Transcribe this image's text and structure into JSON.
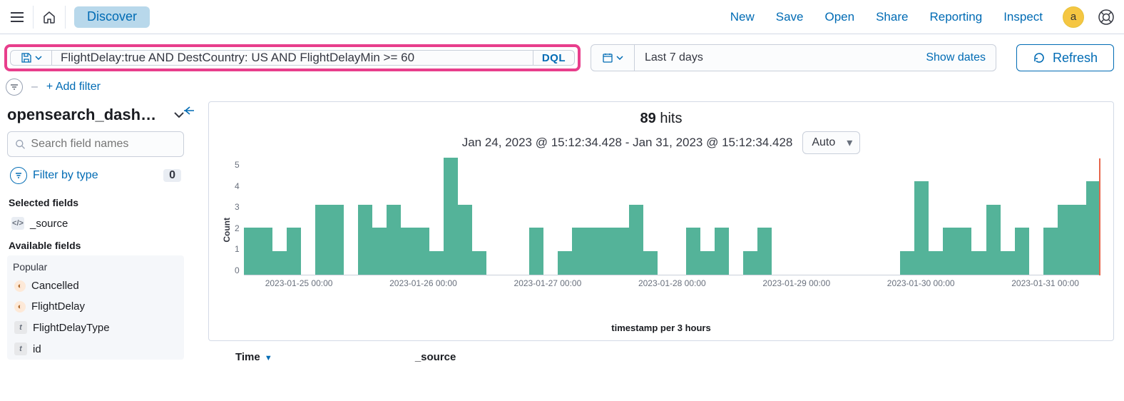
{
  "topnav": {
    "breadcrumb": "Discover",
    "links": [
      "New",
      "Save",
      "Open",
      "Share",
      "Reporting",
      "Inspect"
    ],
    "avatar_initial": "a"
  },
  "querybar": {
    "query_value": "FlightDelay:true AND DestCountry: US AND FlightDelayMin >= 60",
    "lang_label": "DQL",
    "date_label": "Last 7 days",
    "show_dates": "Show dates",
    "refresh_label": "Refresh"
  },
  "filters": {
    "add_filter_label": "+ Add filter"
  },
  "sidebar": {
    "index_pattern": "opensearch_dashbo…",
    "search_placeholder": "Search field names",
    "filter_by_type_label": "Filter by type",
    "filter_by_type_count": "0",
    "selected_heading": "Selected fields",
    "selected": [
      {
        "icon": "code",
        "label": "_source"
      }
    ],
    "available_heading": "Available fields",
    "popular_label": "Popular",
    "popular_fields": [
      {
        "icon": "bool",
        "label": "Cancelled"
      },
      {
        "icon": "bool",
        "label": "FlightDelay"
      },
      {
        "icon": "str",
        "label": "FlightDelayType"
      },
      {
        "icon": "str",
        "label": "id"
      }
    ]
  },
  "results": {
    "hits_count": "89",
    "hits_word": "hits",
    "date_range_text": "Jan 24, 2023 @ 15:12:34.428 - Jan 31, 2023 @ 15:12:34.428",
    "interval": "Auto",
    "xaxis_title": "timestamp per 3 hours",
    "yaxis_title": "Count",
    "table_columns": {
      "time": "Time",
      "source": "_source"
    }
  },
  "chart_data": {
    "type": "bar",
    "xlabel": "timestamp per 3 hours",
    "ylabel": "Count",
    "ylim": [
      0,
      5
    ],
    "y_ticks": [
      0,
      1,
      2,
      3,
      4,
      5
    ],
    "x_ticks": [
      "2023-01-25 00:00",
      "2023-01-26 00:00",
      "2023-01-27 00:00",
      "2023-01-28 00:00",
      "2023-01-29 00:00",
      "2023-01-30 00:00",
      "2023-01-31 00:00"
    ],
    "values": [
      2,
      2,
      1,
      2,
      0,
      3,
      3,
      0,
      3,
      2,
      3,
      2,
      2,
      1,
      5,
      3,
      1,
      0,
      0,
      0,
      2,
      0,
      1,
      2,
      2,
      2,
      2,
      3,
      1,
      0,
      0,
      2,
      1,
      2,
      0,
      1,
      2,
      0,
      0,
      0,
      0,
      0,
      0,
      0,
      0,
      0,
      1,
      4,
      1,
      2,
      2,
      1,
      3,
      1,
      2,
      0,
      2,
      3,
      3,
      4
    ]
  }
}
